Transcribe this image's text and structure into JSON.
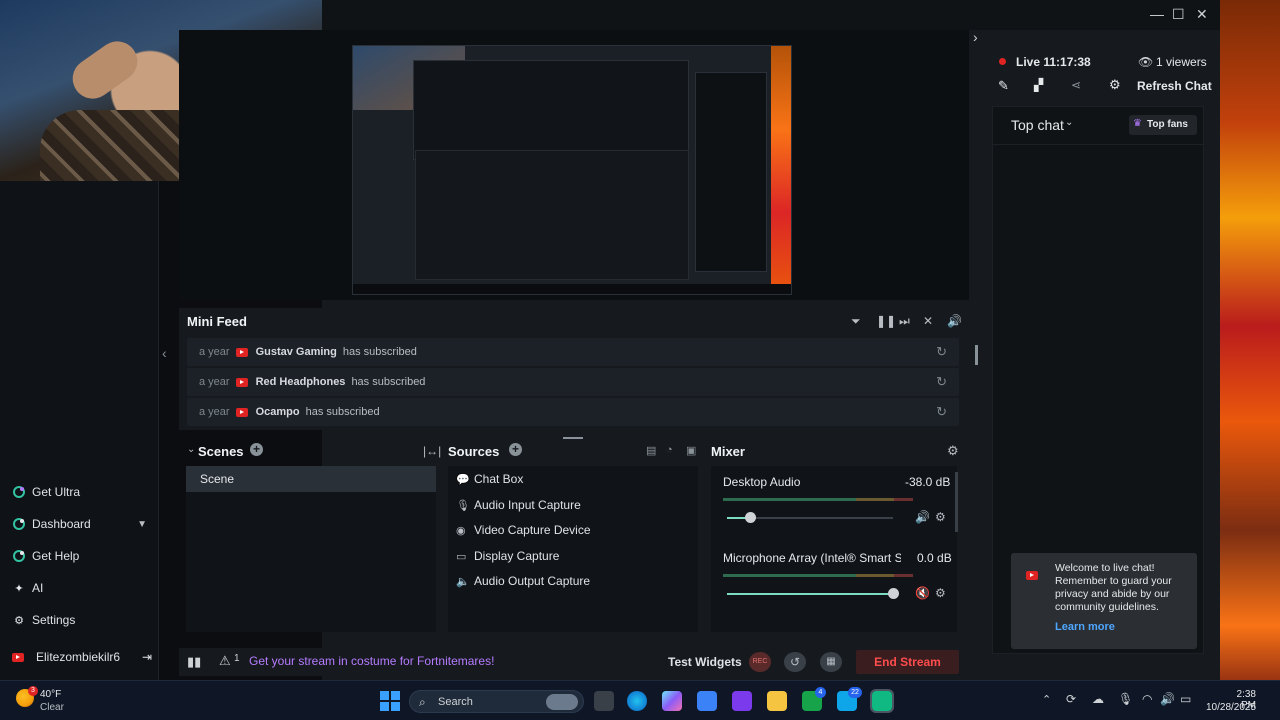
{
  "webcam": {
    "label": "webcam-overlay"
  },
  "window": {
    "minimize": "—",
    "maximize": "☐",
    "close": "✕",
    "collapse": "›"
  },
  "preview": {
    "expand": "‹"
  },
  "sidebar": {
    "items": [
      {
        "label": "Get Ultra",
        "icon": "ultra-icon"
      },
      {
        "label": "Dashboard",
        "icon": "dashboard-icon"
      },
      {
        "label": "Get Help",
        "icon": "help-icon"
      },
      {
        "label": "AI",
        "icon": "ai-icon"
      },
      {
        "label": "Settings",
        "icon": "settings-icon"
      }
    ],
    "user": "Elitezombiekilr6"
  },
  "minifeed": {
    "title": "Mini Feed",
    "rows": [
      {
        "ago": "a year",
        "name": "Gustav Gaming",
        "action": "has subscribed"
      },
      {
        "ago": "a year",
        "name": "Red Headphones",
        "action": "has subscribed"
      },
      {
        "ago": "a year",
        "name": "Ocampo",
        "action": "has subscribed"
      }
    ]
  },
  "scenes": {
    "title": "Scenes",
    "items": [
      "Scene"
    ]
  },
  "sources": {
    "title": "Sources",
    "items": [
      {
        "label": "Chat Box",
        "icon": "chat-icon"
      },
      {
        "label": "Audio Input Capture",
        "icon": "mic-icon"
      },
      {
        "label": "Video Capture Device",
        "icon": "camera-icon"
      },
      {
        "label": "Display Capture",
        "icon": "monitor-icon"
      },
      {
        "label": "Audio Output Capture",
        "icon": "speaker-icon"
      }
    ]
  },
  "mixer": {
    "title": "Mixer",
    "channels": [
      {
        "name": "Desktop Audio",
        "db": "-38.0 dB",
        "level": 0.14
      },
      {
        "name": "Microphone Array (Intel® Smart S...",
        "db": "0.0 dB",
        "level": 1.0
      }
    ]
  },
  "bottombar": {
    "notice_count": "1",
    "promo": "Get your stream in costume for Fortnitemares!",
    "test_widgets": "Test Widgets",
    "rec": "REC",
    "end_stream": "End Stream"
  },
  "chatpanel": {
    "live": "Live 11:17:38",
    "viewers": "1 viewers",
    "refresh": "Refresh Chat",
    "top_chat": "Top chat",
    "top_fans": "Top fans",
    "toast_text": "Welcome to live chat! Remember to guard your privacy and abide by our community guidelines.",
    "toast_link": "Learn more"
  },
  "taskbar": {
    "weather_temp": "40°F",
    "weather_cond": "Clear",
    "weather_badge": "3",
    "search_placeholder": "Search",
    "time": "2:38 PM",
    "date": "10/28/2025",
    "badge_a": "4",
    "badge_b": "22"
  },
  "colors": {
    "accent_purple": "#b57bff",
    "end_red": "#ff4d4d",
    "live_red": "#e02424",
    "link_blue": "#4ea6ff"
  }
}
